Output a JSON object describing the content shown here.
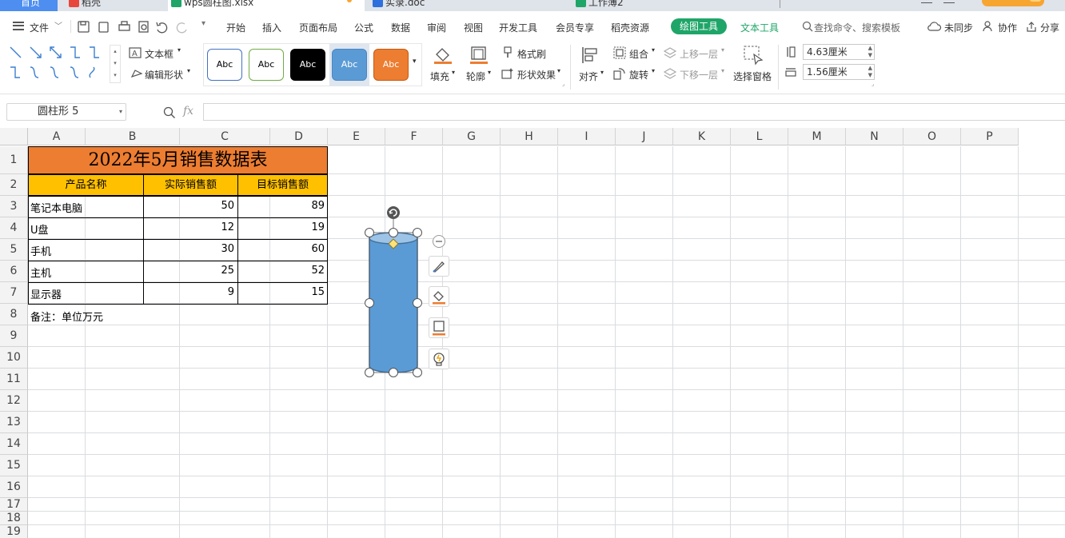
{
  "tabs": {
    "home": "首页",
    "t1": "稻壳",
    "t2": "wps圆柱图.xlsx",
    "t3": "实录.doc",
    "t4": "工作薄2"
  },
  "menu": {
    "file": "文件",
    "items": [
      "开始",
      "插入",
      "页面布局",
      "公式",
      "数据",
      "审阅",
      "视图",
      "开发工具",
      "会员专享",
      "稻壳资源"
    ],
    "draw_tool": "绘图工具",
    "text_tool": "文本工具",
    "search": "查找命令、搜索模板",
    "sync": "未同步",
    "collab": "协作",
    "share": "分享"
  },
  "ribbon": {
    "textbox": "文本框",
    "edit_shape": "编辑形状",
    "abc": "Abc",
    "fill": "填充",
    "outline": "轮廓",
    "format_painter": "格式刷",
    "shape_effect": "形状效果",
    "align": "对齐",
    "group": "组合",
    "rotate": "旋转",
    "bring_forward": "上移一层",
    "send_backward": "下移一层",
    "select_pane": "选择窗格",
    "height": "4.63厘米",
    "width": "1.56厘米",
    "colors": {
      "abc_black": "#000000",
      "abc_blue": "#5b9bd5",
      "abc_orange": "#ed7d31",
      "abc_green_border": "#70ad47",
      "abc_blue_border": "#4472c4"
    }
  },
  "formula_bar": {
    "name_box": "圆柱形 5",
    "fx": "fx",
    "formula": ""
  },
  "grid": {
    "columns": [
      "A",
      "B",
      "C",
      "D",
      "E",
      "F",
      "G",
      "H",
      "I",
      "J",
      "K",
      "L",
      "M",
      "N",
      "O",
      "P"
    ],
    "rows": [
      "1",
      "2",
      "3",
      "4",
      "5",
      "6",
      "7",
      "8",
      "9",
      "10",
      "11",
      "12",
      "13",
      "14",
      "15",
      "16",
      "17",
      "18",
      "19"
    ]
  },
  "table": {
    "title": "2022年5月销售数据表",
    "headers": [
      "产品名称",
      "实际销售额",
      "目标销售额"
    ],
    "rows": [
      [
        "笔记本电脑",
        "50",
        "89"
      ],
      [
        "U盘",
        "12",
        "19"
      ],
      [
        "手机",
        "30",
        "60"
      ],
      [
        "主机",
        "25",
        "52"
      ],
      [
        "显示器",
        "9",
        "15"
      ]
    ],
    "note": "备注：单位万元",
    "colors": {
      "title_bg": "#ed7d31",
      "header_bg": "#ffc000"
    }
  },
  "shape": {
    "fill": "#5b9bd5",
    "top_fill": "#9dc3e6",
    "handle_fill": "#ffe27a"
  }
}
